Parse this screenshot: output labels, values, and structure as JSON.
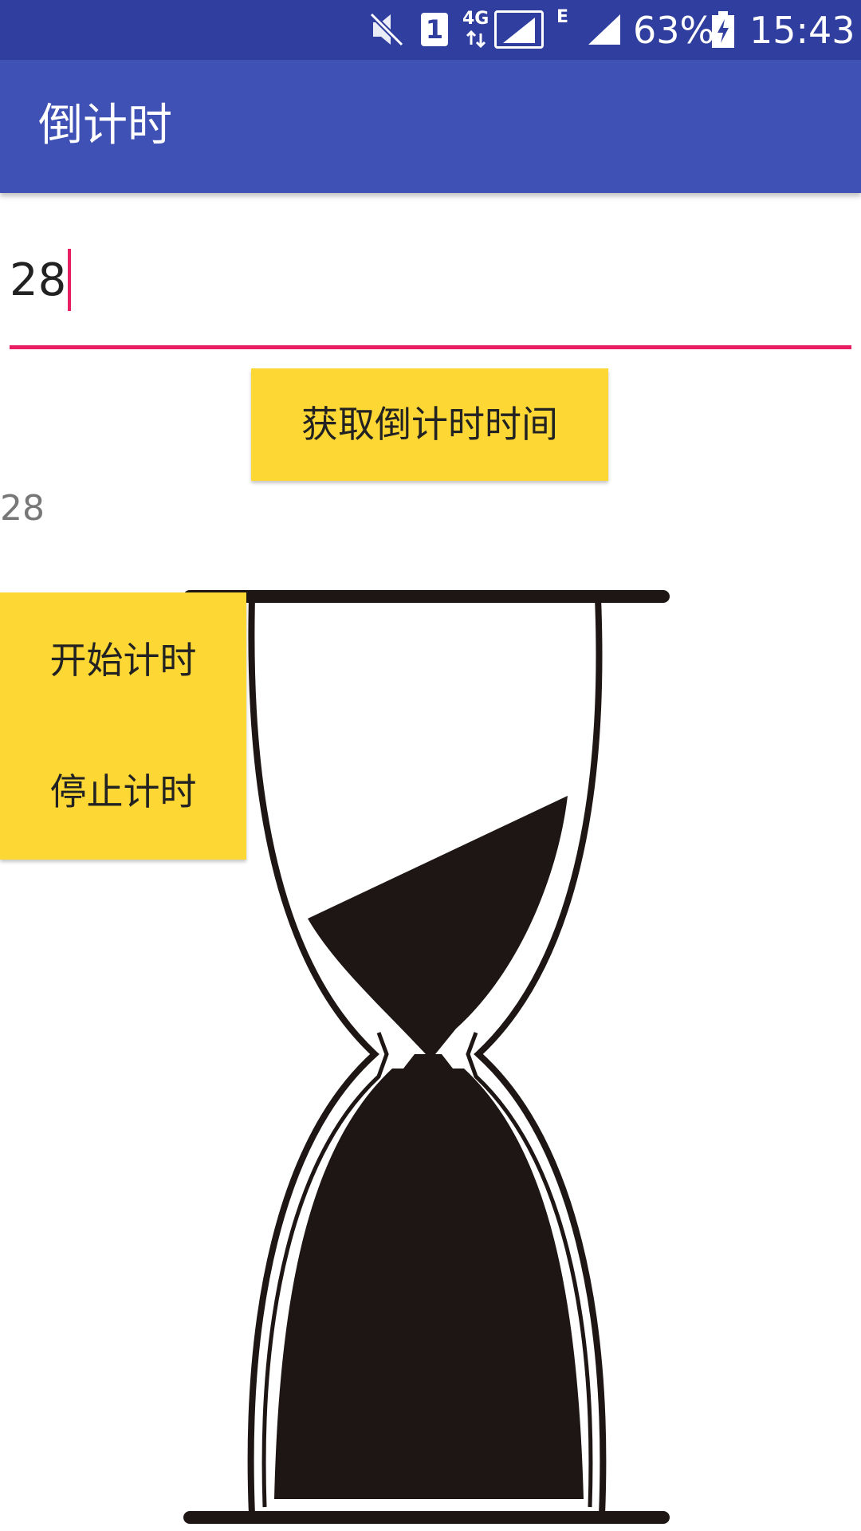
{
  "status_bar": {
    "battery_percent": "63%",
    "time": "15:43",
    "network_label": "4G",
    "edge_label": "E",
    "sim_label": "1",
    "icons": [
      "mute-icon",
      "sim-icon",
      "signal-4g-icon",
      "signal-icon",
      "battery-charging-icon"
    ]
  },
  "app_bar": {
    "title": "倒计时"
  },
  "input": {
    "value": "28"
  },
  "buttons": {
    "get_time": "获取倒计时时间",
    "start": "开始计时",
    "stop": "停止计时"
  },
  "count_display": "28",
  "colors": {
    "status_bar": "#303f9f",
    "app_bar": "#3f51b5",
    "accent": "#e91e63",
    "button": "#fdd835"
  },
  "image": {
    "icon": "hourglass-icon"
  }
}
